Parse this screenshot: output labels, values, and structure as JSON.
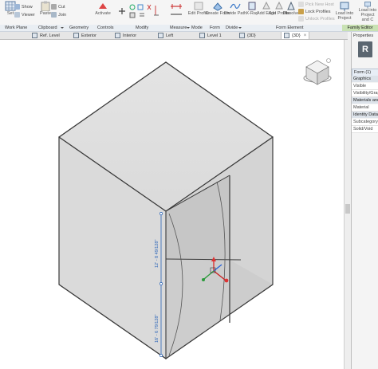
{
  "ribbon": {
    "set_label": "Set",
    "show_label": "Show",
    "viewer_label": "Viewer",
    "paste_label": "Paste",
    "cut_label": "Cut",
    "join_label": "Join",
    "activate_label": "Activate",
    "edit_profile_label": "Edit Profile",
    "create_form_label": "Create Form",
    "divide_path_label": "Divide Path",
    "xray_label": "X-Ray",
    "add_edge_label": "Add Edge",
    "add_profile_label": "Add Profile",
    "dissolve_label": "Dissolve",
    "pick_new_host_label": "Pick New Host",
    "lock_profiles_label": "Lock Profiles",
    "unlock_profiles_label": "Unlock Profiles",
    "load_into_project_label": "Load into Project",
    "load_into_project_close_label": "Load into Project and C"
  },
  "panels": {
    "work_plane": "Work Plane",
    "clipboard": "Clipboard",
    "geometry": "Geometry",
    "controls": "Controls",
    "modify": "Modify",
    "measure": "Measure",
    "mode": "Mode",
    "form": "Form",
    "divide": "Divide",
    "form_element": "Form Element",
    "family_editor": "Family Editor"
  },
  "tabs": [
    {
      "label": "Ref. Level"
    },
    {
      "label": "Exterior"
    },
    {
      "label": "Interior"
    },
    {
      "label": "Left"
    },
    {
      "label": "Level 1"
    },
    {
      "label": "{3D}"
    },
    {
      "label": "{3D}"
    }
  ],
  "properties": {
    "title": "Properties",
    "type_letter": "R",
    "selector": "Form (1)",
    "rows": [
      {
        "label": "Graphics",
        "group": true
      },
      {
        "label": "Visible",
        "group": false
      },
      {
        "label": "Visibility/Grap",
        "group": false
      },
      {
        "label": "Materials and",
        "group": true
      },
      {
        "label": "Material",
        "group": false
      },
      {
        "label": "Identity Data",
        "group": true
      },
      {
        "label": "Subcategory",
        "group": false
      },
      {
        "label": "Solid/Void",
        "group": false
      }
    ]
  },
  "canvas": {
    "dim_top": "12' - 8 49/128\"",
    "dim_bottom": "16' - 6 79/128\""
  },
  "colors": {
    "accent": "#3a78c8",
    "family_editor_bg": "#c9e2b3",
    "cube_face": "#d8d8d8",
    "cube_edge": "#3a3a3a",
    "dimension": "#2a64b8"
  }
}
